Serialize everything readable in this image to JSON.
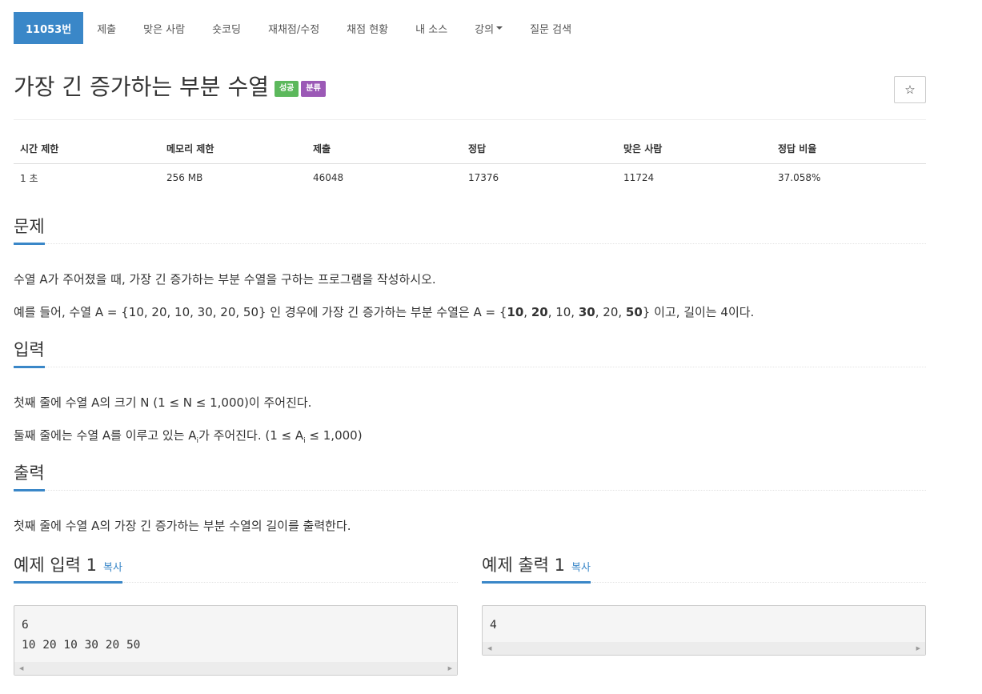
{
  "nav": {
    "problem_id": "11053번",
    "items": [
      "제출",
      "맞은 사람",
      "숏코딩",
      "재채점/수정",
      "채점 현황",
      "내 소스",
      "강의",
      "질문 검색"
    ]
  },
  "problem": {
    "title": "가장 긴 증가하는 부분 수열",
    "badge_status": "성공",
    "badge_category": "분류",
    "star": "☆"
  },
  "info_table": {
    "headers": [
      "시간 제한",
      "메모리 제한",
      "제출",
      "정답",
      "맞은 사람",
      "정답 비율"
    ],
    "values": [
      "1 초",
      "256 MB",
      "46048",
      "17376",
      "11724",
      "37.058%"
    ]
  },
  "description": {
    "heading": "문제",
    "line1": "수열 A가 주어졌을 때, 가장 긴 증가하는 부분 수열을 구하는 프로그램을 작성하시오.",
    "line2": {
      "prefix": "예를 들어, 수열 A = {10, 20, 10, 30, 20, 50} 인 경우에 가장 긴 증가하는 부분 수열은 A = {",
      "n1": "10",
      "sep": ", ",
      "n2": "20",
      "mid1": ", 10, ",
      "n3": "30",
      "mid2": ", 20, ",
      "n4": "50",
      "suffix": "} 이고, 길이는 4이다."
    }
  },
  "input": {
    "heading": "입력",
    "line1": "첫째 줄에 수열 A의 크기 N (1 ≤ N ≤ 1,000)이 주어진다.",
    "line2": {
      "prefix": "둘째 줄에는 수열 A를 이루고 있는 A",
      "sub": "i",
      "middle": "가 주어진다. (1 ≤ A",
      "sub2": "i",
      "suffix": " ≤ 1,000)"
    }
  },
  "output": {
    "heading": "출력",
    "line1": "첫째 줄에 수열 A의 가장 긴 증가하는 부분 수열의 길이를 출력한다."
  },
  "samples": {
    "input_title": "예제 입력 1",
    "output_title": "예제 출력 1",
    "copy_label": "복사",
    "input_code": "6\n10 20 10 30 20 50",
    "output_code": "4"
  }
}
